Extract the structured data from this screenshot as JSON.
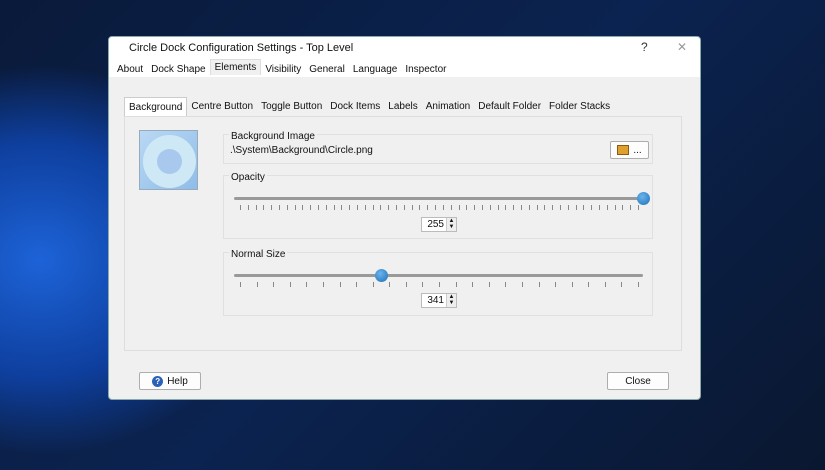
{
  "window": {
    "title": "Circle Dock Configuration Settings - Top Level",
    "help_glyph": "?",
    "close_glyph": "✕"
  },
  "tabs": [
    "About",
    "Dock Shape",
    "Elements",
    "Visibility",
    "General",
    "Language",
    "Inspector"
  ],
  "active_tab": "Elements",
  "subtabs": [
    "Background",
    "Centre Button",
    "Toggle Button",
    "Dock Items",
    "Labels",
    "Animation",
    "Default Folder",
    "Folder Stacks"
  ],
  "background_image": {
    "label": "Background Image",
    "path": ".\\System\\Background\\Circle.png",
    "browse_label": "..."
  },
  "opacity": {
    "label": "Opacity",
    "value": "255",
    "fraction": 1.0
  },
  "normal_size": {
    "label": "Normal Size",
    "value": "341",
    "fraction": 0.36
  },
  "footer": {
    "help": "Help",
    "close": "Close"
  }
}
